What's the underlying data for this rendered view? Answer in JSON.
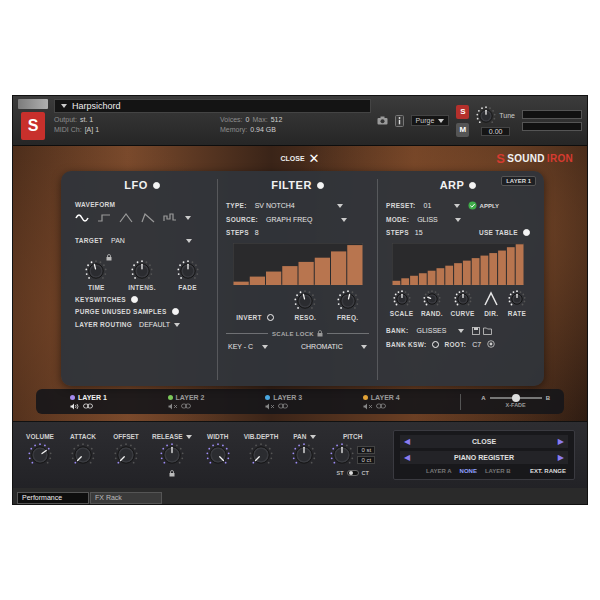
{
  "header": {
    "logo": "S",
    "instrument": "Harpsichord",
    "output_label": "Output:",
    "output": "st. 1",
    "midi_label": "MIDI Ch:",
    "midi": "[A] 1",
    "voices_label": "Voices:",
    "voices": "0",
    "max_label": "Max:",
    "max": "512",
    "memory_label": "Memory:",
    "memory": "0.94 GB",
    "purge": "Purge",
    "s_button": "S",
    "m_button": "M",
    "tune_label": "Tune",
    "tune": "0.00",
    "tune_level": 0.5
  },
  "close": {
    "label": "CLOSE",
    "icon": "✕"
  },
  "brand": {
    "mark": "S",
    "name_a": "SOUND",
    "name_b": "IRON"
  },
  "layer_badge": "LAYER 1",
  "lfo": {
    "title": "LFO",
    "on": true,
    "waveform_label": "WAVEFORM",
    "waveforms": [
      {
        "kind": "sine",
        "selected": true
      },
      {
        "kind": "step",
        "selected": false
      },
      {
        "kind": "triangle",
        "selected": false
      },
      {
        "kind": "ramp",
        "selected": false
      },
      {
        "kind": "random",
        "selected": false
      }
    ],
    "target_label": "TARGET",
    "target": "PAN",
    "knobs": [
      {
        "label": "TIME",
        "level": 0.45,
        "locked": true
      },
      {
        "label": "INTENS.",
        "level": 0.5,
        "locked": false
      },
      {
        "label": "FADE",
        "level": 0.5,
        "locked": false
      }
    ],
    "keyswitches": {
      "label": "KEYSWITCHES",
      "on": true
    },
    "purge": {
      "label": "PURGE UNUSED SAMPLES",
      "on": true
    },
    "routing": {
      "label": "LAYER ROUTING",
      "value": "DEFAULT"
    }
  },
  "filter": {
    "title": "FILTER",
    "on": true,
    "type_label": "TYPE:",
    "type": "SV NOTCH4",
    "source_label": "SOURCE:",
    "source": "GRAPH FREQ",
    "steps_label": "STEPS",
    "steps": "8",
    "graph": [
      0.08,
      0.2,
      0.32,
      0.45,
      0.55,
      0.65,
      0.8,
      0.95
    ],
    "invert": {
      "label": "INVERT",
      "on": false
    },
    "knobs": [
      {
        "label": "RESO.",
        "level": 0.45
      },
      {
        "label": "FREQ.",
        "level": 0.55
      }
    ]
  },
  "scale_lock": {
    "label": "SCALE LOCK",
    "key": "KEY - C",
    "scale": "CHROMATIC"
  },
  "arp": {
    "title": "ARP",
    "on": true,
    "preset_label": "PRESET:",
    "preset": "01",
    "apply": {
      "label": "APPLY",
      "checked": true
    },
    "mode_label": "MODE:",
    "mode": "GLISS",
    "steps_label": "STEPS",
    "steps": "15",
    "use_table": {
      "label": "USE TABLE",
      "on": true
    },
    "graph": [
      0.1,
      0.16,
      0.22,
      0.28,
      0.34,
      0.4,
      0.46,
      0.52,
      0.58,
      0.64,
      0.7,
      0.76,
      0.82,
      0.9,
      0.97
    ],
    "knobs": [
      {
        "label": "SCALE",
        "kind": "knob",
        "level": 0.5
      },
      {
        "label": "RAND.",
        "kind": "knob",
        "level": 0.25
      },
      {
        "label": "CURVE",
        "kind": "knob",
        "level": 0.5
      },
      {
        "label": "DIR.",
        "kind": "direction",
        "level": 0
      },
      {
        "label": "RATE",
        "kind": "knob",
        "level": 0.5
      }
    ],
    "bank_label": "BANK:",
    "bank": "GLISSES",
    "bank_ksw": {
      "label": "BANK KSW:",
      "on": false
    },
    "root_label": "ROOT:",
    "root": "C7"
  },
  "layers": [
    {
      "label": "LAYER 1",
      "selected": true,
      "muted": false,
      "color": "#a58cf0"
    },
    {
      "label": "LAYER 2",
      "selected": false,
      "muted": true,
      "color": "#7cc95a"
    },
    {
      "label": "LAYER 3",
      "selected": false,
      "muted": true,
      "color": "#4aa8e2"
    },
    {
      "label": "LAYER 4",
      "selected": false,
      "muted": true,
      "color": "#e3a336"
    }
  ],
  "xfade": {
    "a": "A",
    "b": "B",
    "label": "X-FADE",
    "level": 0.5
  },
  "controls": [
    {
      "label": "VOLUME",
      "level": 0.7,
      "menu": false,
      "locked": false
    },
    {
      "label": "ATTACK",
      "level": 0,
      "menu": false,
      "locked": false
    },
    {
      "label": "OFFSET",
      "level": 0,
      "menu": false,
      "locked": false
    },
    {
      "label": "RELEASE",
      "level": 0.5,
      "menu": true,
      "locked": true
    },
    {
      "label": "WIDTH",
      "level": 1,
      "menu": false,
      "locked": false
    },
    {
      "label": "VIB.DEPTH",
      "level": 0,
      "menu": false,
      "locked": false
    },
    {
      "label": "PAN",
      "level": 0.5,
      "menu": true,
      "locked": false
    }
  ],
  "pitch": {
    "label": "PITCH",
    "level": 0.5,
    "values": [
      "0 st",
      "0 ct"
    ],
    "st_label": "ST",
    "ct_label": "CT",
    "ct_selected": false
  },
  "selectors": [
    {
      "label": "CLOSE",
      "prev": "◀",
      "next": "▶"
    },
    {
      "label": "PIANO REGISTER",
      "prev": "◀",
      "next": "▶"
    }
  ],
  "layer_pick": [
    {
      "label": "LAYER A",
      "selected": false
    },
    {
      "label": "NONE",
      "selected": true
    },
    {
      "label": "LAYER B",
      "selected": false
    }
  ],
  "ext_range": "EXT. RANGE",
  "tabs": [
    {
      "label": "Performance",
      "selected": true
    },
    {
      "label": "FX Rack",
      "selected": false
    }
  ]
}
